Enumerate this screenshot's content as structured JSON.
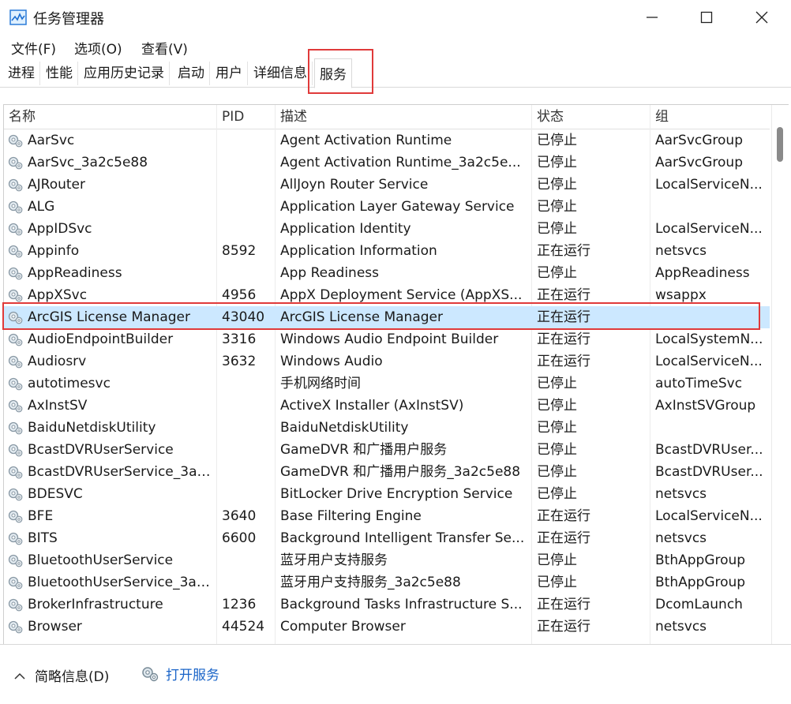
{
  "window": {
    "title": "任务管理器"
  },
  "menu": [
    "文件(F)",
    "选项(O)",
    "查看(V)"
  ],
  "tabs": [
    "进程",
    "性能",
    "应用历史记录",
    "启动",
    "用户",
    "详细信息",
    "服务"
  ],
  "active_tab": "服务",
  "columns": {
    "name": "名称",
    "pid": "PID",
    "desc": "描述",
    "status": "状态",
    "group": "组"
  },
  "rows": [
    {
      "name": "AarSvc",
      "pid": "",
      "desc": "Agent Activation Runtime",
      "status": "已停止",
      "group": "AarSvcGroup"
    },
    {
      "name": "AarSvc_3a2c5e88",
      "pid": "",
      "desc": "Agent Activation Runtime_3a2c5e...",
      "status": "已停止",
      "group": "AarSvcGroup"
    },
    {
      "name": "AJRouter",
      "pid": "",
      "desc": "AllJoyn Router Service",
      "status": "已停止",
      "group": "LocalServiceN..."
    },
    {
      "name": "ALG",
      "pid": "",
      "desc": "Application Layer Gateway Service",
      "status": "已停止",
      "group": ""
    },
    {
      "name": "AppIDSvc",
      "pid": "",
      "desc": "Application Identity",
      "status": "已停止",
      "group": "LocalServiceN..."
    },
    {
      "name": "Appinfo",
      "pid": "8592",
      "desc": "Application Information",
      "status": "正在运行",
      "group": "netsvcs"
    },
    {
      "name": "AppReadiness",
      "pid": "",
      "desc": "App Readiness",
      "status": "已停止",
      "group": "AppReadiness"
    },
    {
      "name": "AppXSvc",
      "pid": "4956",
      "desc": "AppX Deployment Service (AppXS...",
      "status": "正在运行",
      "group": "wsappx"
    },
    {
      "name": "ArcGIS License Manager",
      "pid": "43040",
      "desc": "ArcGIS License Manager",
      "status": "正在运行",
      "group": "",
      "selected": true
    },
    {
      "name": "AudioEndpointBuilder",
      "pid": "3316",
      "desc": "Windows Audio Endpoint Builder",
      "status": "正在运行",
      "group": "LocalSystemN..."
    },
    {
      "name": "Audiosrv",
      "pid": "3632",
      "desc": "Windows Audio",
      "status": "正在运行",
      "group": "LocalServiceN..."
    },
    {
      "name": "autotimesvc",
      "pid": "",
      "desc": "手机网络时间",
      "status": "已停止",
      "group": "autoTimeSvc"
    },
    {
      "name": "AxInstSV",
      "pid": "",
      "desc": "ActiveX Installer (AxInstSV)",
      "status": "已停止",
      "group": "AxInstSVGroup"
    },
    {
      "name": "BaiduNetdiskUtility",
      "pid": "",
      "desc": "BaiduNetdiskUtility",
      "status": "已停止",
      "group": ""
    },
    {
      "name": "BcastDVRUserService",
      "pid": "",
      "desc": "GameDVR 和广播用户服务",
      "status": "已停止",
      "group": "BcastDVRUser..."
    },
    {
      "name": "BcastDVRUserService_3a2...",
      "pid": "",
      "desc": "GameDVR 和广播用户服务_3a2c5e88",
      "status": "已停止",
      "group": "BcastDVRUser..."
    },
    {
      "name": "BDESVC",
      "pid": "",
      "desc": "BitLocker Drive Encryption Service",
      "status": "已停止",
      "group": "netsvcs"
    },
    {
      "name": "BFE",
      "pid": "3640",
      "desc": "Base Filtering Engine",
      "status": "正在运行",
      "group": "LocalServiceN..."
    },
    {
      "name": "BITS",
      "pid": "6600",
      "desc": "Background Intelligent Transfer Se...",
      "status": "正在运行",
      "group": "netsvcs"
    },
    {
      "name": "BluetoothUserService",
      "pid": "",
      "desc": "蓝牙用户支持服务",
      "status": "已停止",
      "group": "BthAppGroup"
    },
    {
      "name": "BluetoothUserService_3a2...",
      "pid": "",
      "desc": "蓝牙用户支持服务_3a2c5e88",
      "status": "已停止",
      "group": "BthAppGroup"
    },
    {
      "name": "BrokerInfrastructure",
      "pid": "1236",
      "desc": "Background Tasks Infrastructure S...",
      "status": "正在运行",
      "group": "DcomLaunch"
    },
    {
      "name": "Browser",
      "pid": "44524",
      "desc": "Computer Browser",
      "status": "正在运行",
      "group": "netsvcs"
    }
  ],
  "footer": {
    "fewer_details": "简略信息(D)",
    "open_services": "打开服务"
  },
  "colors": {
    "selected_row": "#cce8ff",
    "highlight": "#e03a3a",
    "link": "#1a64c8"
  }
}
